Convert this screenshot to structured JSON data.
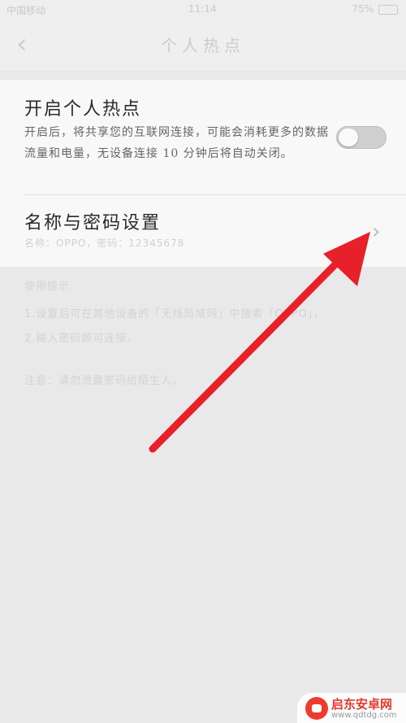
{
  "status_bar": {
    "carrier": "中国移动",
    "time": "11:14",
    "battery": "75%"
  },
  "nav": {
    "back_glyph": "‹",
    "title": "个人热点"
  },
  "hotspot": {
    "title": "开启个人热点",
    "description": "开启后，将共享您的互联网连接，可能会消耗更多的数据流量和电量，无设备连接 10 分钟后将自动关闭。",
    "toggle_on": false
  },
  "name_password": {
    "title": "名称与密码设置",
    "subtitle": "名称：OPPO，密码：12345678",
    "chevron": "›"
  },
  "tips": {
    "heading": "使用提示",
    "line1": "1.设置后可在其他设备的「无线局域网」中搜索「OPPO」，",
    "line2": "2.输入密码即可连接。",
    "note": "注意：请勿泄露密码给陌生人。"
  },
  "watermark": {
    "name": "启东安卓网",
    "url": "www.qdtdg.com"
  },
  "colors": {
    "arrow": "#e8202a",
    "toggle_off": "#cfcfcf",
    "background": "#e9e9e9"
  }
}
